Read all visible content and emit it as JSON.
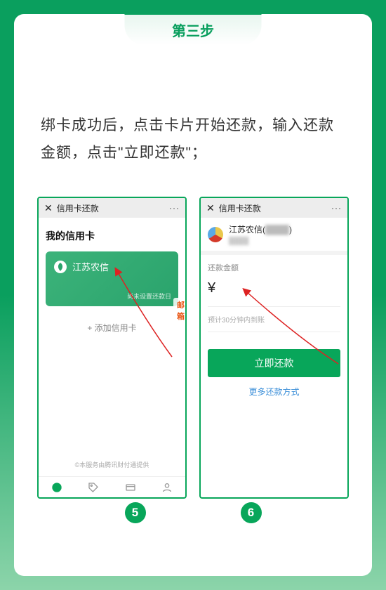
{
  "step_label": "第三步",
  "instruction": "绑卡成功后，点击卡片开始还款，输入还款金额，点击\"立即还款\"；",
  "email_badge": "邮箱",
  "phone1": {
    "title": "信用卡还款",
    "heading": "我的信用卡",
    "bank_name": "江苏农信",
    "card_note": "尚未设置还款日",
    "add_card": "+ 添加信用卡",
    "footer": "©本服务由腾讯财付通提供"
  },
  "phone2": {
    "title": "信用卡还款",
    "bank_name": "江苏农信(",
    "bank_masked": "████",
    "bank_tail": ")",
    "amount_label": "还款金额",
    "currency": "¥",
    "eta": "预计30分钟内到账",
    "pay_button": "立即还款",
    "more_ways": "更多还款方式"
  },
  "circles": {
    "left": "5",
    "right": "6"
  }
}
